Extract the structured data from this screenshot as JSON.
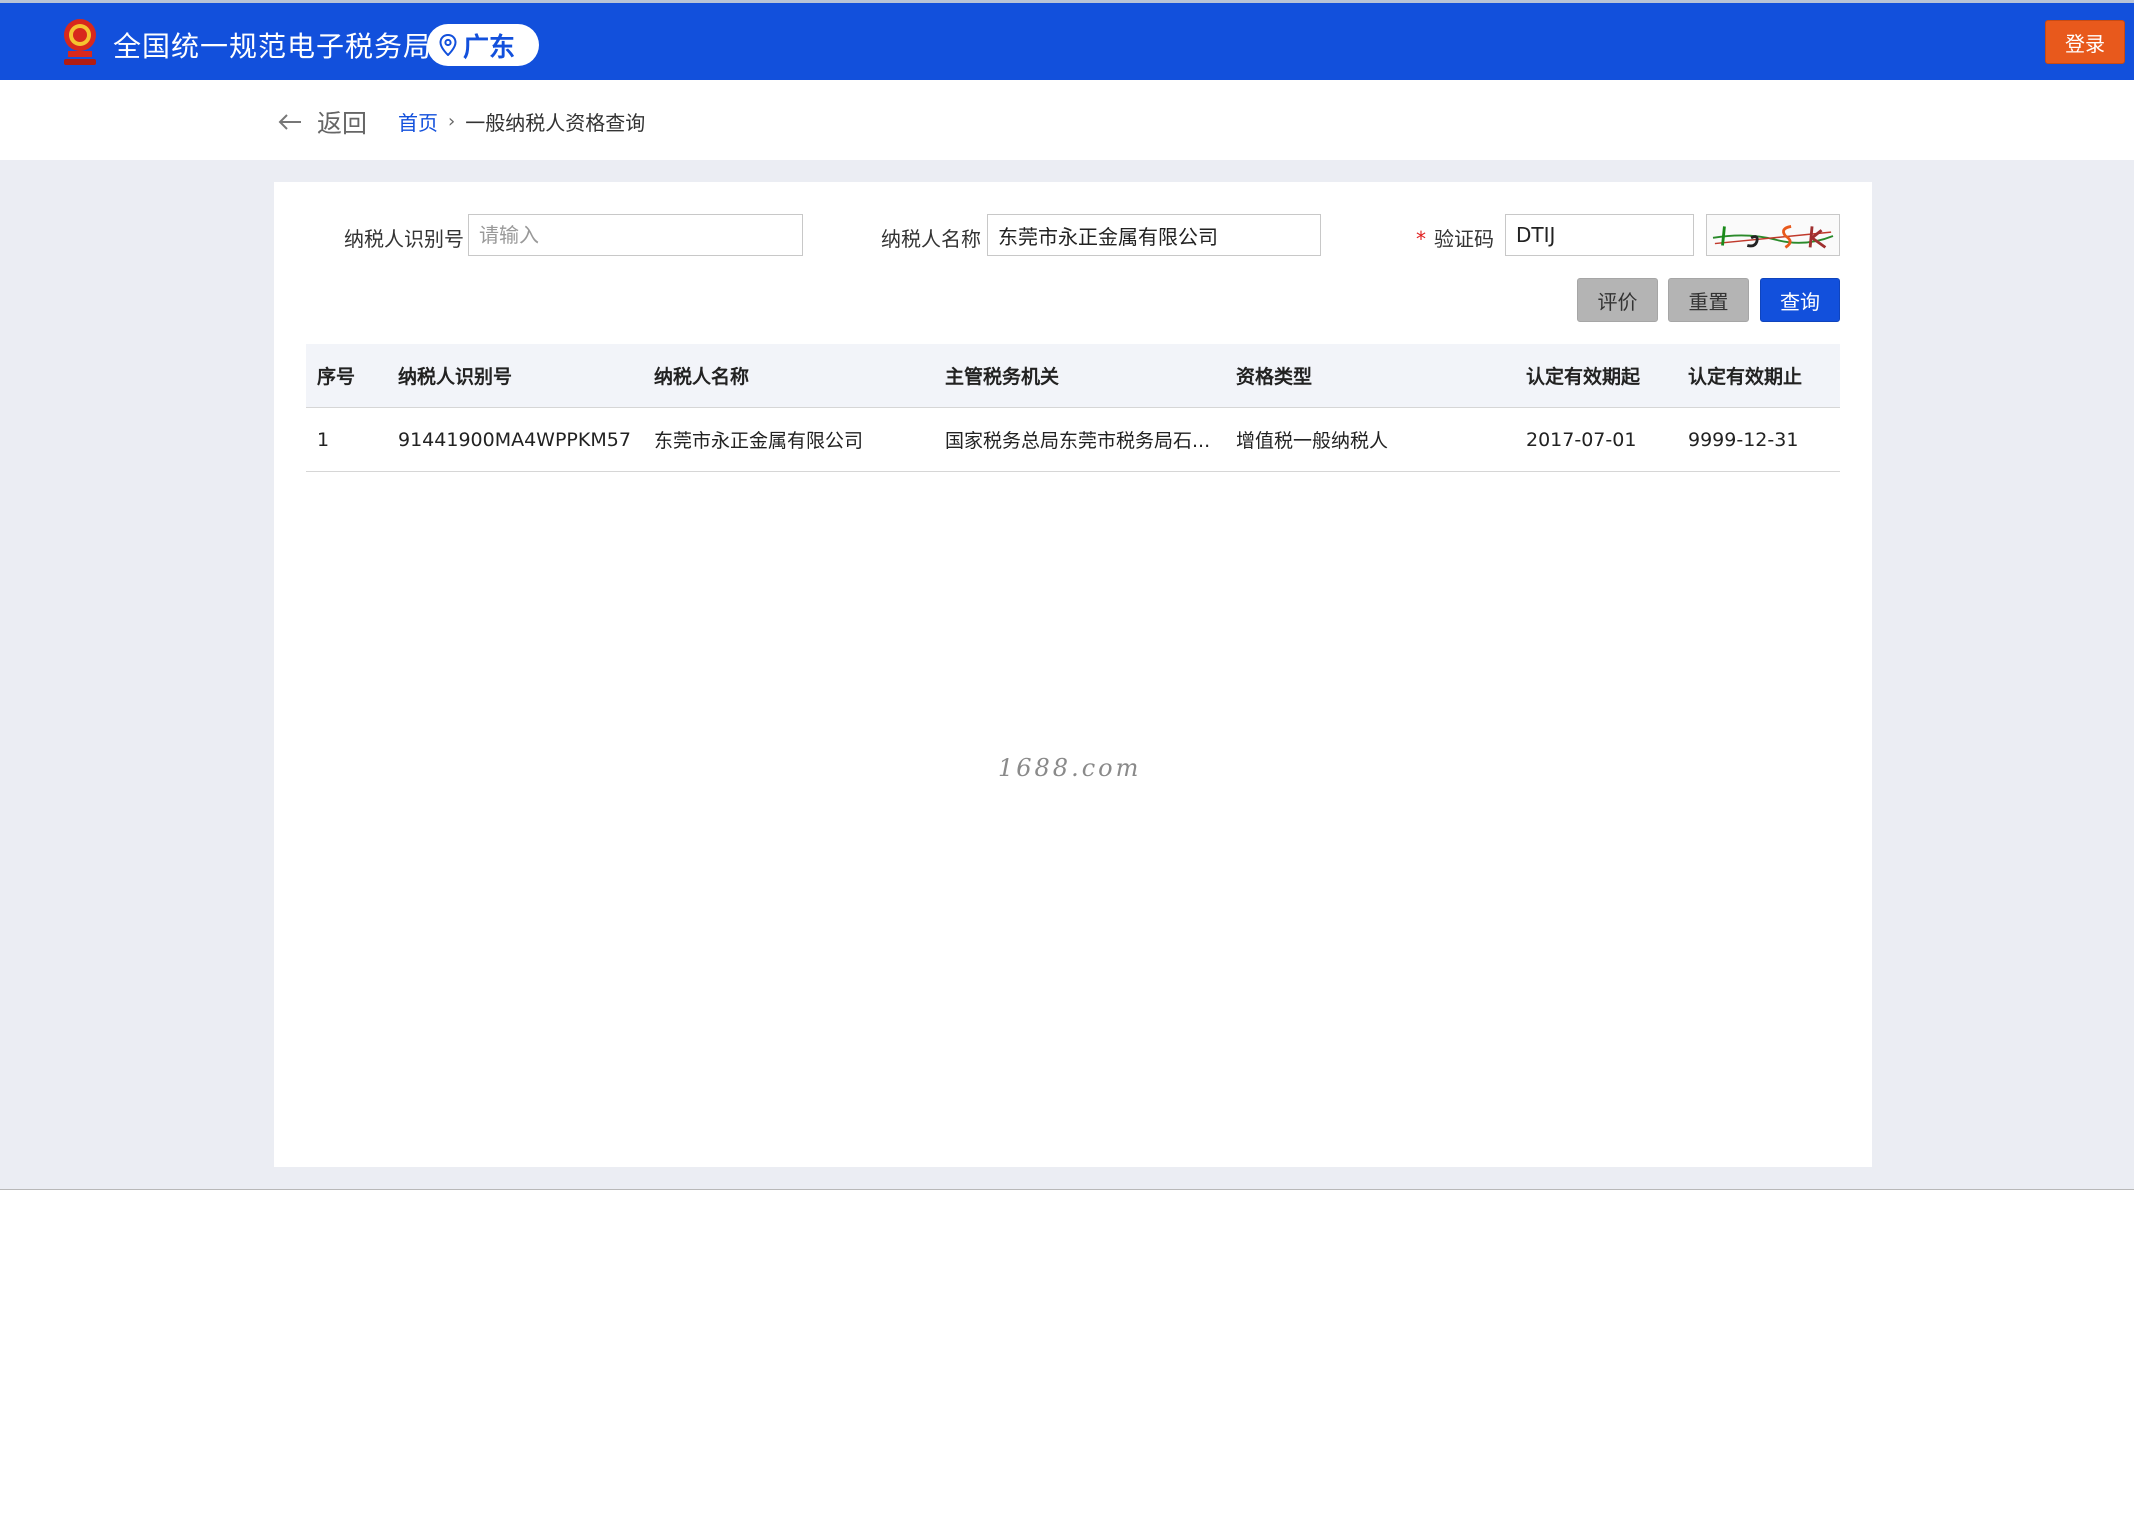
{
  "header": {
    "site_title": "全国统一规范电子税务局",
    "region": "广东",
    "login_label": "登录"
  },
  "nav": {
    "back_label": "返回",
    "breadcrumb_home": "首页",
    "breadcrumb_separator": "›",
    "breadcrumb_current": "一般纳税人资格查询"
  },
  "form": {
    "taxpayer_id": {
      "label": "纳税人识别号",
      "value": "",
      "placeholder": "请输入"
    },
    "taxpayer_name": {
      "label": "纳税人名称",
      "value": "东莞市永正金属有限公司"
    },
    "captcha": {
      "required_mark": "*",
      "label": "验证码",
      "value": "DTIJ"
    },
    "buttons": {
      "evaluate": "评价",
      "reset": "重置",
      "query": "查询"
    }
  },
  "table": {
    "headers": [
      "序号",
      "纳税人识别号",
      "纳税人名称",
      "主管税务机关",
      "资格类型",
      "认定有效期起",
      "认定有效期止"
    ],
    "rows": [
      [
        "1",
        "91441900MA4WPPKM57",
        "东莞市永正金属有限公司",
        "国家税务总局东莞市税务局石...",
        "增值税一般纳税人",
        "2017-07-01",
        "9999-12-31"
      ]
    ]
  },
  "watermark": "1688.com",
  "colors": {
    "header_blue": "#1250dc",
    "login_orange": "#e8591c",
    "page_gray": "#ebedf3"
  }
}
